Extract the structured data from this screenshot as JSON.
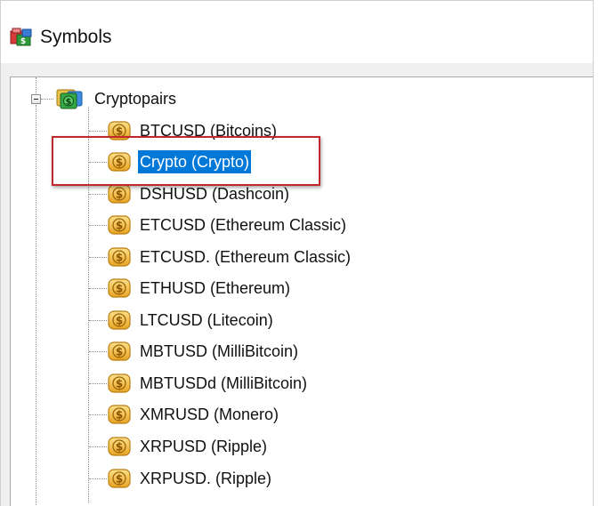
{
  "window": {
    "title": "Symbols",
    "title_icon": "symbols-folder-icon"
  },
  "tree": {
    "root": {
      "label": "Cryptopairs",
      "icon": "dollar-folder-icon",
      "expanded": true
    },
    "items": [
      {
        "label": "BTCUSD  (Bitcoins)",
        "icon": "dollar-coin-icon",
        "selected": false
      },
      {
        "label": "Crypto  (Crypto)",
        "icon": "dollar-coin-icon",
        "selected": true
      },
      {
        "label": "DSHUSD  (Dashcoin)",
        "icon": "dollar-coin-icon",
        "selected": false
      },
      {
        "label": "ETCUSD  (Ethereum Classic)",
        "icon": "dollar-coin-icon",
        "selected": false
      },
      {
        "label": "ETCUSD.  (Ethereum Classic)",
        "icon": "dollar-coin-icon",
        "selected": false
      },
      {
        "label": "ETHUSD  (Ethereum)",
        "icon": "dollar-coin-icon",
        "selected": false
      },
      {
        "label": "LTCUSD  (Litecoin)",
        "icon": "dollar-coin-icon",
        "selected": false
      },
      {
        "label": "MBTUSD  (MilliBitcoin)",
        "icon": "dollar-coin-icon",
        "selected": false
      },
      {
        "label": "MBTUSDd  (MilliBitcoin)",
        "icon": "dollar-coin-icon",
        "selected": false
      },
      {
        "label": "XMRUSD  (Monero)",
        "icon": "dollar-coin-icon",
        "selected": false
      },
      {
        "label": "XRPUSD  (Ripple)",
        "icon": "dollar-coin-icon",
        "selected": false
      },
      {
        "label": "XRPUSD.  (Ripple)",
        "icon": "dollar-coin-icon",
        "selected": false
      }
    ]
  },
  "colors": {
    "selection": "#0078d7",
    "highlight_box": "#c0282d",
    "coin": "#f0b437",
    "folder": "#2e9a3a"
  }
}
